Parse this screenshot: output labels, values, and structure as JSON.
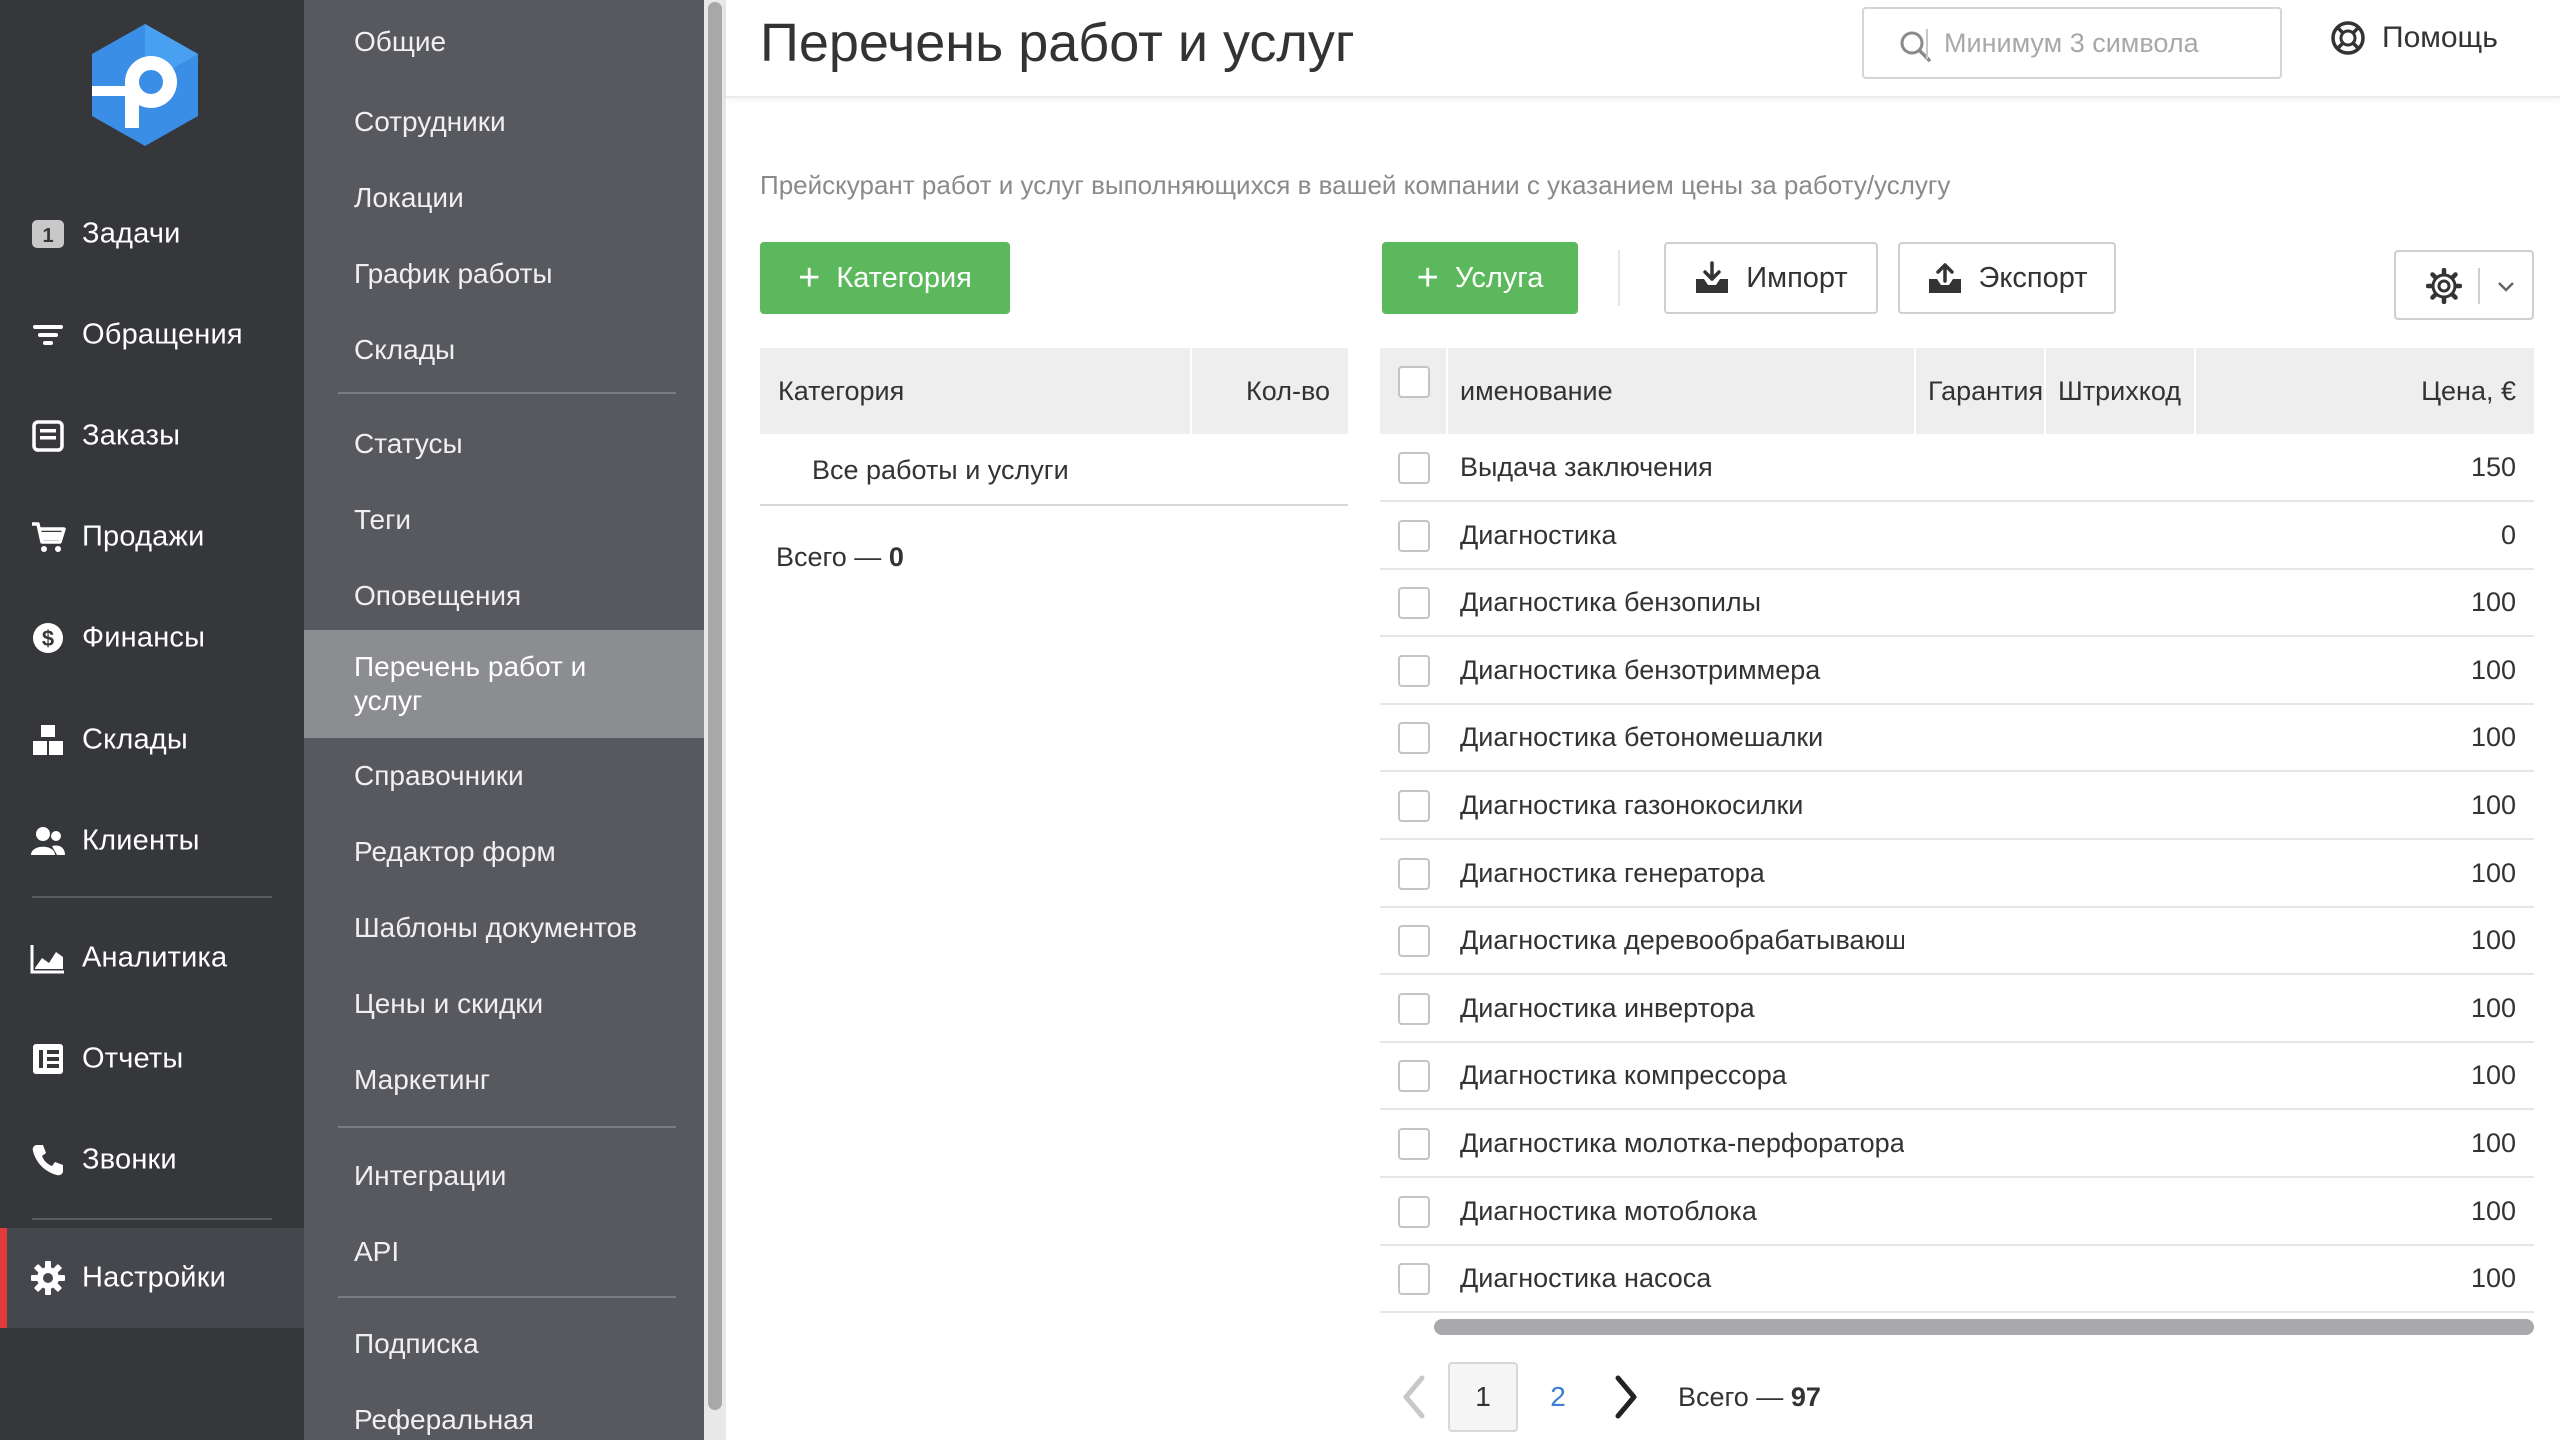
{
  "nav": {
    "logo_alt": "P",
    "items": [
      {
        "label": "Задачи",
        "icon": "tasks-badge-icon",
        "badge": "1"
      },
      {
        "label": "Обращения",
        "icon": "filter-icon"
      },
      {
        "label": "Заказы",
        "icon": "orders-icon"
      },
      {
        "label": "Продажи",
        "icon": "cart-icon"
      },
      {
        "label": "Финансы",
        "icon": "dollar-icon"
      },
      {
        "label": "Склады",
        "icon": "boxes-icon"
      },
      {
        "label": "Клиенты",
        "icon": "users-icon"
      },
      {
        "label": "Аналитика",
        "icon": "chart-area-icon"
      },
      {
        "label": "Отчеты",
        "icon": "reports-icon"
      },
      {
        "label": "Звонки",
        "icon": "phone-icon"
      },
      {
        "label": "Настройки",
        "icon": "gear-icon",
        "active": true
      }
    ]
  },
  "subnav": {
    "items": [
      "Общие",
      "Сотрудники",
      "Локации",
      "График работы",
      "Склады",
      "Статусы",
      "Теги",
      "Оповещения",
      "Перечень работ и услуг",
      "Справочники",
      "Редактор форм",
      "Шаблоны документов",
      "Цены и скидки",
      "Маркетинг",
      "Интеграции",
      "API",
      "Подписка",
      "Реферальная"
    ],
    "active_index": 8
  },
  "header": {
    "title": "Перечень работ и услуг",
    "search_placeholder": "Минимум 3 символа",
    "help_label": "Помощь"
  },
  "main": {
    "description": "Прейскурант работ и услуг выполняющихся в вашей компании с указанием цены за работу/услугу",
    "add_category_label": "Категория",
    "add_service_label": "Услуга",
    "import_label": "Импорт",
    "export_label": "Экспорт"
  },
  "categories": {
    "col_name": "Категория",
    "col_count": "Кол-во",
    "all_label": "Все работы и услуги",
    "total_label": "Всего — ",
    "total_value": "0"
  },
  "services": {
    "columns": {
      "name": "именование",
      "warranty": "Гарантия",
      "barcode": "Штрихкод",
      "price": "Цена, €"
    },
    "rows": [
      {
        "name": "Выдача заключения",
        "price": "150"
      },
      {
        "name": "Диагностика",
        "price": "0"
      },
      {
        "name": "Диагностика бензопилы",
        "price": "100"
      },
      {
        "name": "Диагностика бензотриммера",
        "price": "100"
      },
      {
        "name": "Диагностика бетономешалки",
        "price": "100"
      },
      {
        "name": "Диагностика газонокосилки",
        "price": "100"
      },
      {
        "name": "Диагностика генератора",
        "price": "100"
      },
      {
        "name": "Диагностика деревообрабатывающ",
        "price": "100"
      },
      {
        "name": "Диагностика инвертора",
        "price": "100"
      },
      {
        "name": "Диагностика компрессора",
        "price": "100"
      },
      {
        "name": "Диагностика молотка-перфоратора",
        "price": "100"
      },
      {
        "name": "Диагностика мотоблока",
        "price": "100"
      },
      {
        "name": "Диагностика насоса",
        "price": "100"
      }
    ]
  },
  "pagination": {
    "pages": [
      "1",
      "2"
    ],
    "current": "1",
    "total_label": "Всего — ",
    "total_value": "97"
  },
  "colors": {
    "nav_bg": "#36373b",
    "subnav_bg": "#58595e",
    "accent_green": "#5cb85c",
    "active_marker": "#e23b3b",
    "logo_blue": "#3a8ee6"
  }
}
